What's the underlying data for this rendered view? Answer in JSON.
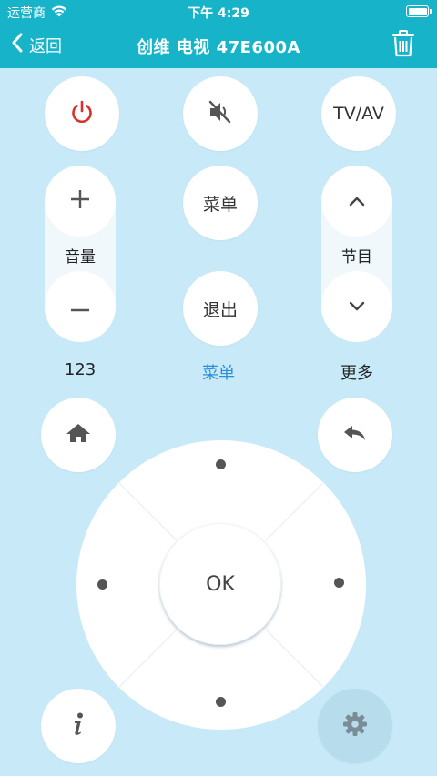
{
  "status_bar": {
    "carrier": "运营商",
    "time": "下午 4:29"
  },
  "header": {
    "back_label": "返回",
    "title": "创维 电视 47E600A"
  },
  "top_row": {
    "tv_av_label": "TV/AV"
  },
  "volume": {
    "label": "音量"
  },
  "center": {
    "menu_label": "菜单",
    "exit_label": "退出"
  },
  "channel": {
    "label": "节目"
  },
  "bottom_labels": {
    "numbers": "123",
    "menu": "菜单",
    "more": "更多"
  },
  "dpad": {
    "ok_label": "OK"
  },
  "colors": {
    "header": "#17b3c8",
    "background": "#c8e9f7",
    "power_icon": "#d9302c",
    "active_label": "#2a8fd8"
  },
  "icons": [
    "power-icon",
    "mute-icon",
    "plus-icon",
    "minus-icon",
    "chevron-up-icon",
    "chevron-down-icon",
    "home-icon",
    "return-icon",
    "info-icon",
    "gear-icon",
    "trash-icon",
    "wifi-icon",
    "battery-icon",
    "chevron-left-icon"
  ]
}
